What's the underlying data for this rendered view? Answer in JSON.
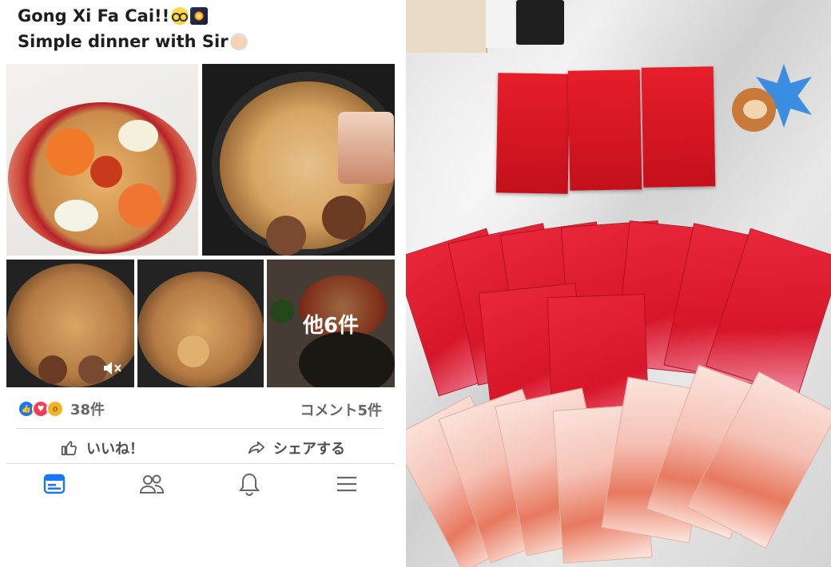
{
  "post": {
    "line1": "Gong Xi Fa Cai!!",
    "line2": "Simple dinner with Sir"
  },
  "photos": {
    "more_label": "他6件"
  },
  "reactions": {
    "count": "38件",
    "comments": "コメント5件"
  },
  "actions": {
    "like": "いいね！",
    "share": "シェアする"
  },
  "icons": [
    "news-feed-icon",
    "friends-icon",
    "notifications-icon",
    "menu-icon",
    "mute-icon",
    "like-icon",
    "share-icon"
  ],
  "colors": {
    "facebook_blue": "#1877f2",
    "red_envelope": "#d8162a"
  }
}
